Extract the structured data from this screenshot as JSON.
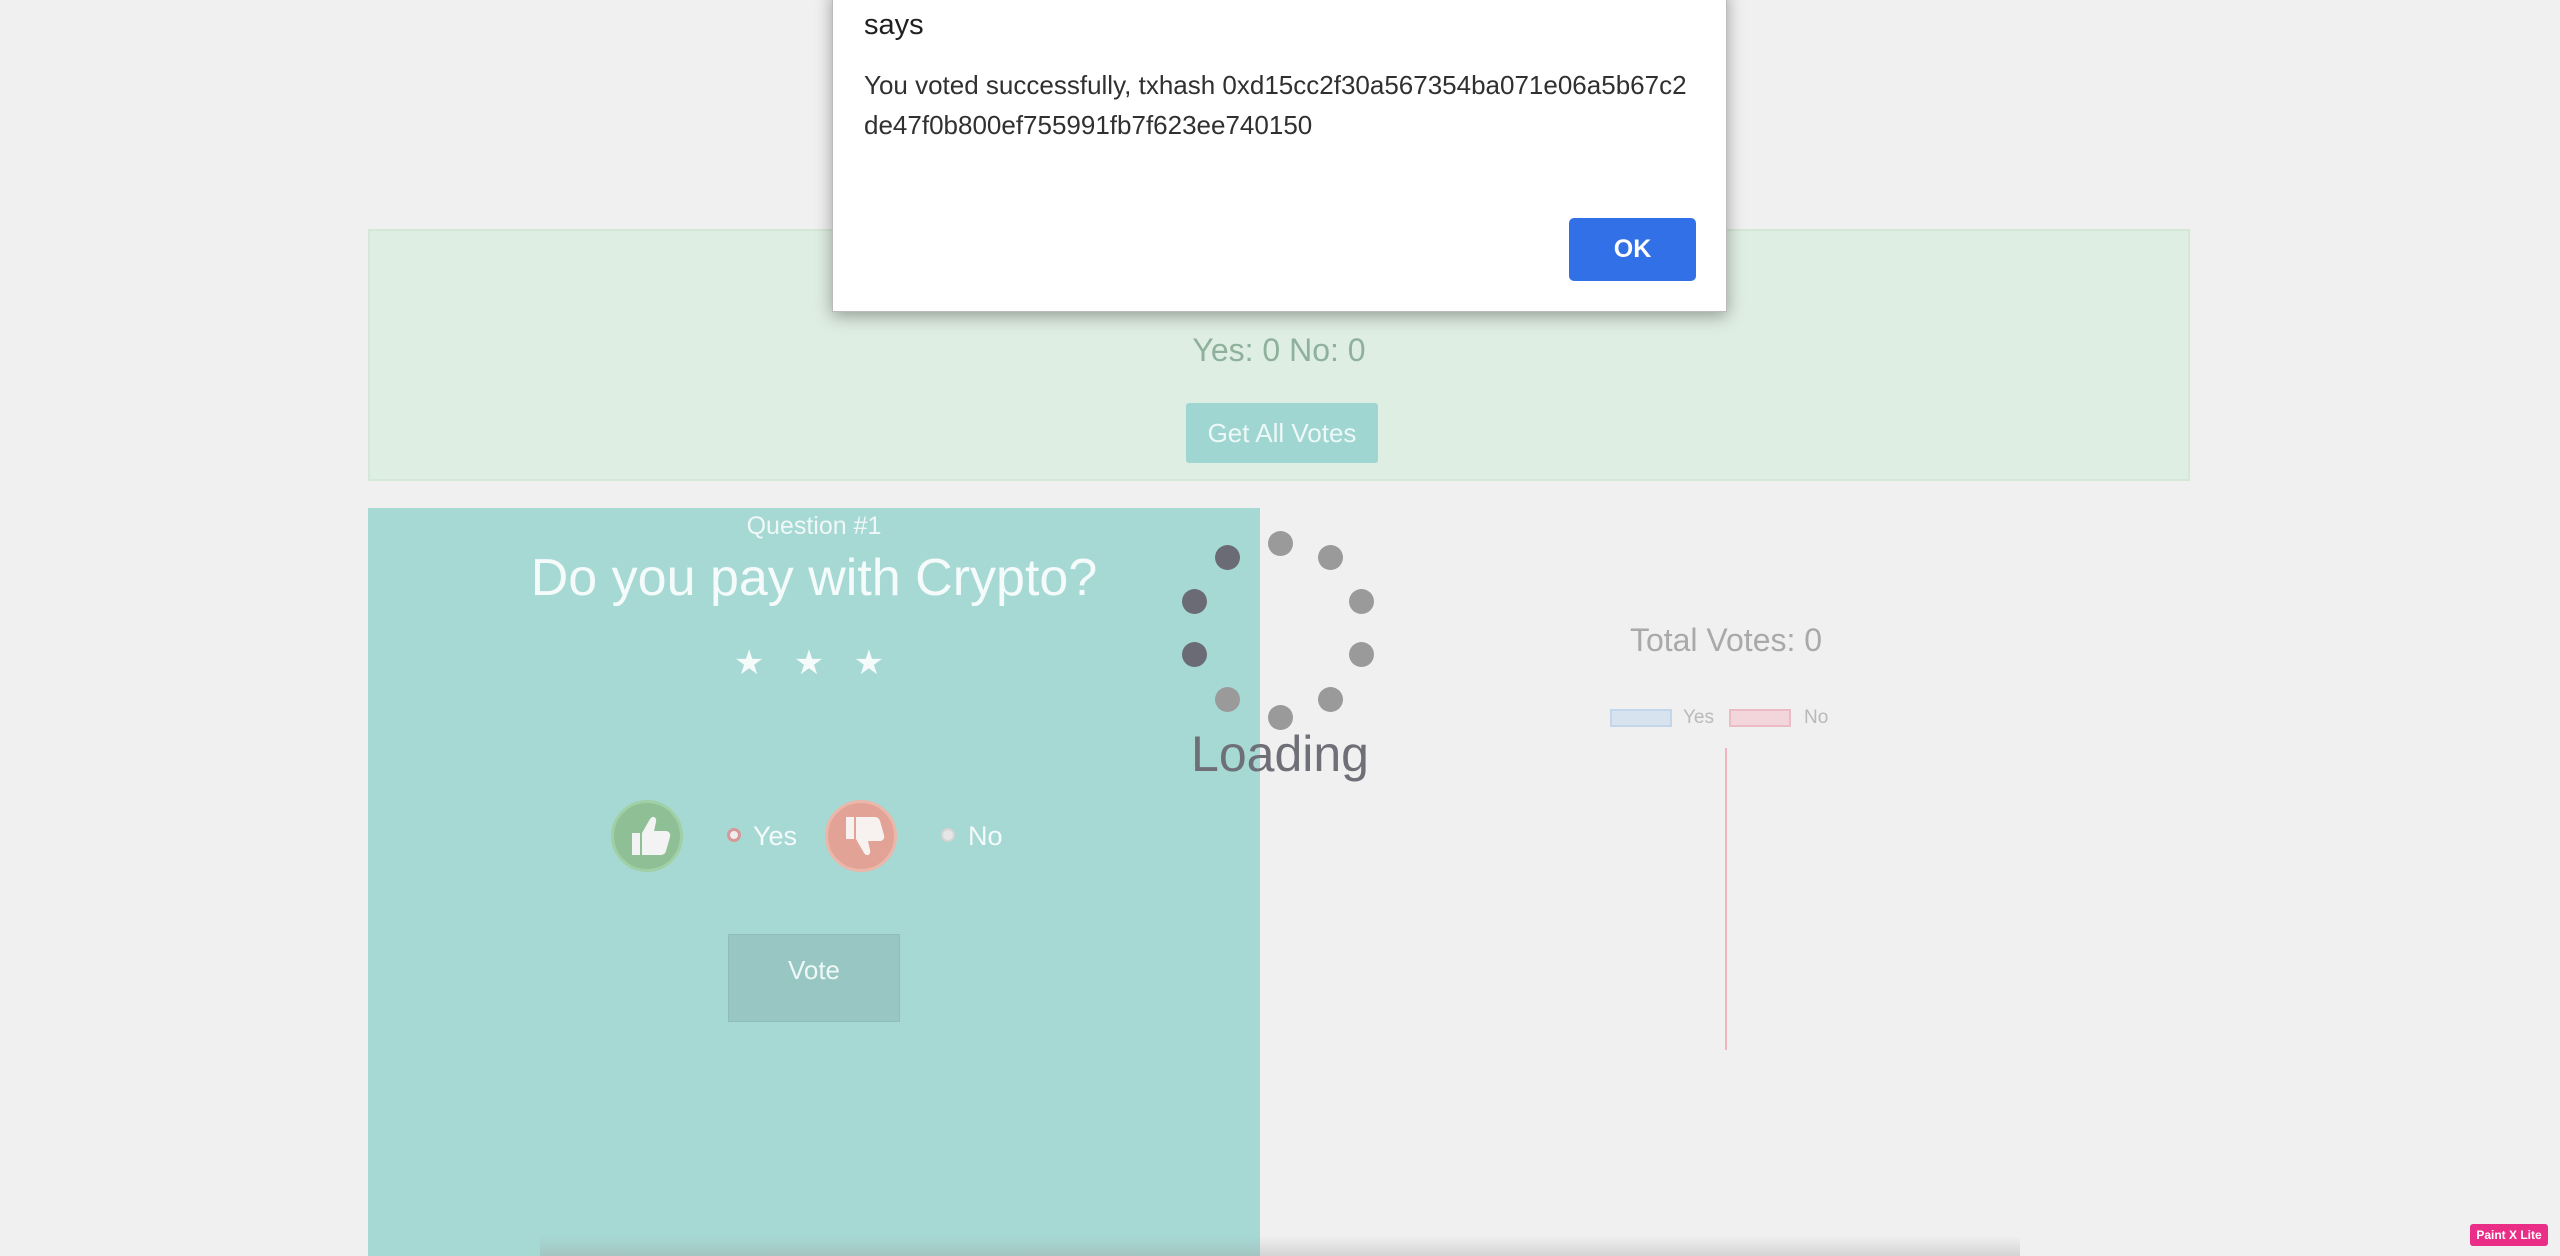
{
  "results": {
    "tally": "Yes: 0 No: 0",
    "get_votes_label": "Get All Votes"
  },
  "question": {
    "number_label": "Question #1",
    "text": "Do you pay with Crypto?",
    "rating_stars": "★ ★ ★",
    "yes_label": "Yes",
    "no_label": "No",
    "vote_label": "Vote"
  },
  "loading": {
    "text": "Loading"
  },
  "chart": {
    "total_votes": "Total Votes: 0",
    "legend_yes": "Yes",
    "legend_no": "No"
  },
  "dialog": {
    "title": "says",
    "message": "You voted successfully, txhash 0xd15cc2f30a567354ba071e06a5b67c2de47f0b800ef755991fb7f623ee740150",
    "ok_label": "OK"
  },
  "badge": {
    "text": "Paint X Lite"
  },
  "colors": {
    "ok_button": "#3270e8",
    "question_card": "#a6d9d4",
    "results_panel": "#dfeee2"
  }
}
